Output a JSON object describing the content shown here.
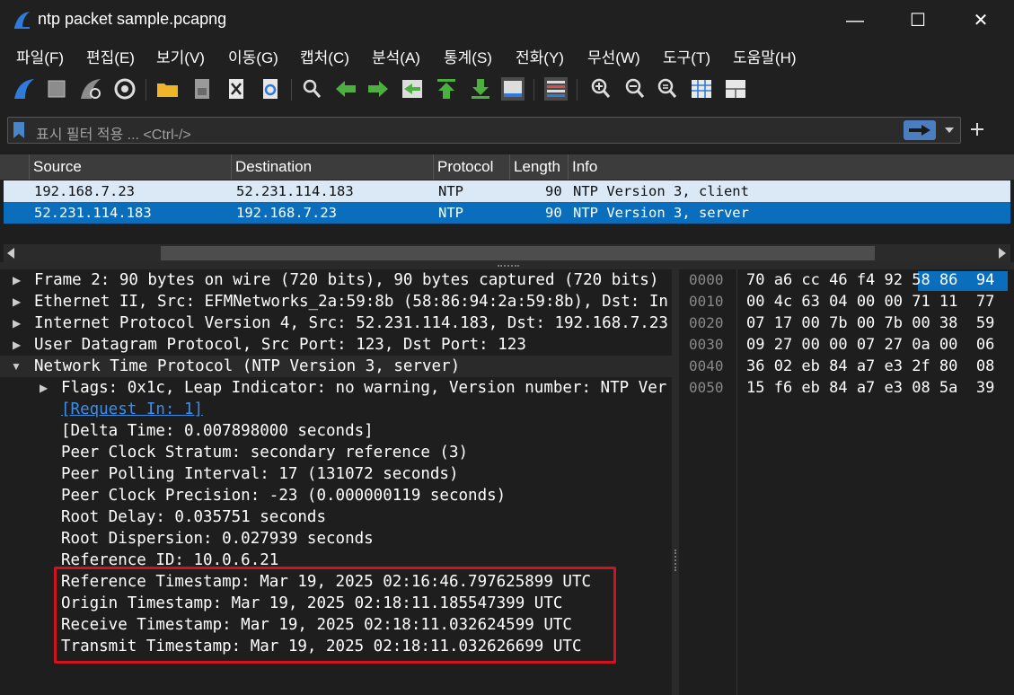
{
  "window": {
    "title": "ntp packet sample.pcapng",
    "minimize_glyph": "—",
    "maximize_glyph": "☐",
    "close_glyph": "✕"
  },
  "menu": [
    "파일(F)",
    "편집(E)",
    "보기(V)",
    "이동(G)",
    "캡처(C)",
    "분석(A)",
    "통계(S)",
    "전화(Y)",
    "무선(W)",
    "도구(T)",
    "도움말(H)"
  ],
  "toolbar": {
    "icons": [
      "start-capture-icon",
      "stop-capture-icon",
      "restart-capture-icon",
      "capture-options-icon",
      "open-file-icon",
      "save-file-icon",
      "close-file-icon",
      "reload-file-icon",
      "find-packet-icon",
      "go-back-icon",
      "go-forward-icon",
      "go-to-packet-icon",
      "first-packet-icon",
      "last-packet-icon",
      "autoscroll-icon",
      "colorize-icon",
      "zoom-in-icon",
      "zoom-out-icon",
      "normal-size-icon",
      "resize-columns-icon",
      "layout-icon"
    ]
  },
  "filter": {
    "placeholder": "표시 필터 적용 ... <Ctrl-/>"
  },
  "packet_list": {
    "columns": [
      "Source",
      "Destination",
      "Protocol",
      "Length",
      "Info"
    ],
    "rows": [
      {
        "source": "192.168.7.23",
        "destination": "52.231.114.183",
        "protocol": "NTP",
        "length": "90",
        "info": "NTP Version 3, client",
        "selected": false
      },
      {
        "source": "52.231.114.183",
        "destination": "192.168.7.23",
        "protocol": "NTP",
        "length": "90",
        "info": "NTP Version 3, server",
        "selected": true
      }
    ]
  },
  "details": {
    "tree": [
      {
        "text": "Frame 2: 90 bytes on wire (720 bits), 90 bytes captured (720 bits)",
        "expander": "▶"
      },
      {
        "text": "Ethernet II, Src: EFMNetworks_2a:59:8b (58:86:94:2a:59:8b), Dst: In",
        "expander": "▶"
      },
      {
        "text": "Internet Protocol Version 4, Src: 52.231.114.183, Dst: 192.168.7.23",
        "expander": "▶"
      },
      {
        "text": "User Datagram Protocol, Src Port: 123, Dst Port: 123",
        "expander": "▶"
      },
      {
        "text": "Network Time Protocol (NTP Version 3, server)",
        "expander": "▼"
      }
    ],
    "ntp_fields": [
      {
        "text": "Flags: 0x1c, Leap Indicator: no warning, Version number: NTP Ver",
        "expander": "▶",
        "link": false
      },
      {
        "text": "[Request In: 1]",
        "expander": "",
        "link": true
      },
      {
        "text": "[Delta Time: 0.007898000 seconds]",
        "expander": "",
        "link": false
      },
      {
        "text": "Peer Clock Stratum: secondary reference (3)",
        "expander": "",
        "link": false
      },
      {
        "text": "Peer Polling Interval: 17 (131072 seconds)",
        "expander": "",
        "link": false
      },
      {
        "text": "Peer Clock Precision: -23 (0.000000119 seconds)",
        "expander": "",
        "link": false
      },
      {
        "text": "Root Delay: 0.035751 seconds",
        "expander": "",
        "link": false
      },
      {
        "text": "Root Dispersion: 0.027939 seconds",
        "expander": "",
        "link": false
      },
      {
        "text": "Reference ID: 10.0.6.21",
        "expander": "",
        "link": false
      },
      {
        "text": "Reference Timestamp: Mar 19, 2025 02:16:46.797625899 UTC",
        "expander": "",
        "link": false
      },
      {
        "text": "Origin Timestamp: Mar 19, 2025 02:18:11.185547399 UTC",
        "expander": "",
        "link": false
      },
      {
        "text": "Receive Timestamp: Mar 19, 2025 02:18:11.032624599 UTC",
        "expander": "",
        "link": false
      },
      {
        "text": "Transmit Timestamp: Mar 19, 2025 02:18:11.032626699 UTC",
        "expander": "",
        "link": false
      }
    ]
  },
  "hex": {
    "rows": [
      {
        "offset": "0000",
        "bytes": "70 a6 cc 46 f4 92 58 86  94"
      },
      {
        "offset": "0010",
        "bytes": "00 4c 63 04 00 00 71 11  77"
      },
      {
        "offset": "0020",
        "bytes": "07 17 00 7b 00 7b 00 38  59"
      },
      {
        "offset": "0030",
        "bytes": "09 27 00 00 07 27 0a 00  06"
      },
      {
        "offset": "0040",
        "bytes": "36 02 eb 84 a7 e3 2f 80  08"
      },
      {
        "offset": "0050",
        "bytes": "15 f6 eb 84 a7 e3 08 5a  39"
      }
    ],
    "highlight_color": "#0a6ebd"
  },
  "colors": {
    "selected_row": "#0a6ebd",
    "client_row": "#dbe9f7",
    "annotation_box": "#d0141e",
    "link": "#3b8eea"
  }
}
